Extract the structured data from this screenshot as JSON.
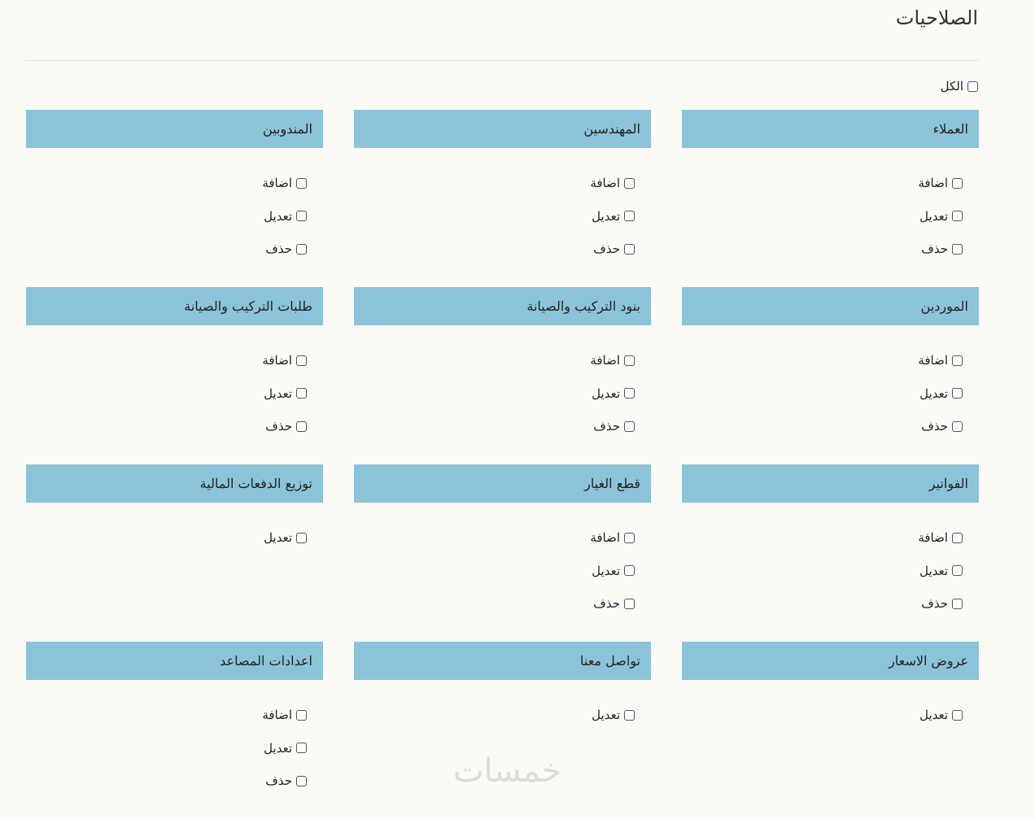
{
  "page": {
    "title": "الصلاحيات",
    "all_label": "الكل"
  },
  "sections": [
    {
      "title": "العملاء",
      "permissions": [
        "اضافة",
        "تعديل",
        "حذف"
      ]
    },
    {
      "title": "المهندسين",
      "permissions": [
        "اضافة",
        "تعديل",
        "حذف"
      ]
    },
    {
      "title": "المندوبين",
      "permissions": [
        "اضافة",
        "تعديل",
        "حذف"
      ]
    },
    {
      "title": "الموردين",
      "permissions": [
        "اضافة",
        "تعديل",
        "حذف"
      ]
    },
    {
      "title": "بنود التركيب والصيانة",
      "permissions": [
        "اضافة",
        "تعديل",
        "حذف"
      ]
    },
    {
      "title": "طلبات التركيب والصيانة",
      "permissions": [
        "اضافة",
        "تعديل",
        "حذف"
      ]
    },
    {
      "title": "الفواتير",
      "permissions": [
        "اضافة",
        "تعديل",
        "حذف"
      ]
    },
    {
      "title": "قطع الغيار",
      "permissions": [
        "اضافة",
        "تعديل",
        "حذف"
      ]
    },
    {
      "title": "توزيع الدفعات المالية",
      "permissions": [
        "تعديل"
      ]
    },
    {
      "title": "عروض الاسعار",
      "permissions": [
        "تعديل"
      ]
    },
    {
      "title": "تواصل معنا",
      "permissions": [
        "تعديل"
      ]
    },
    {
      "title": "اعدادات المصاعد",
      "permissions": [
        "اضافة",
        "تعديل",
        "حذف"
      ]
    }
  ],
  "watermark": "خمسات",
  "colors": {
    "background": "#fcfaf5",
    "section_header": "#8bc4d8"
  }
}
